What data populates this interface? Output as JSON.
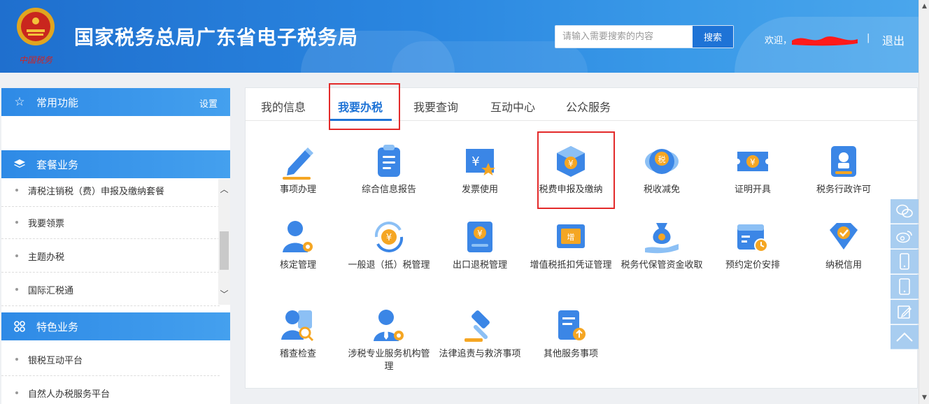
{
  "header": {
    "site_title": "国家税务总局广东省电子税务局",
    "emblem_caption": "中国税务",
    "search_placeholder": "请输入需要搜索的内容",
    "search_button": "搜索",
    "welcome": "欢迎，",
    "separator": "|",
    "logout": "退出"
  },
  "sidebar": {
    "sections": [
      {
        "title": "常用功能",
        "icon": "star-icon",
        "action": "设置"
      },
      {
        "title": "套餐业务",
        "icon": "layers-icon"
      },
      {
        "title": "特色业务",
        "icon": "grid-icon"
      }
    ],
    "package_items": [
      "清税注销税（费）申报及缴纳套餐",
      "我要领票",
      "主题办税",
      "国际汇税通"
    ],
    "feature_items": [
      "银税互动平台",
      "自然人办税服务平台"
    ]
  },
  "tabs": [
    "我的信息",
    "我要办税",
    "我要查询",
    "互动中心",
    "公众服务"
  ],
  "active_tab": "我要办税",
  "services": [
    {
      "label": "事项办理",
      "icon": "pencil-icon"
    },
    {
      "label": "综合信息报告",
      "icon": "document-list-icon"
    },
    {
      "label": "发票使用",
      "icon": "invoice-star-icon"
    },
    {
      "label": "税费申报及缴纳",
      "icon": "yuan-box-icon"
    },
    {
      "label": "税收减免",
      "icon": "tax-coin-icon"
    },
    {
      "label": "证明开具",
      "icon": "yuan-ticket-icon"
    },
    {
      "label": "税务行政许可",
      "icon": "license-stamp-icon"
    },
    {
      "label": "核定管理",
      "icon": "user-gear-icon"
    },
    {
      "label": "一般退（抵）税管理",
      "icon": "yuan-refund-icon"
    },
    {
      "label": "出口退税管理",
      "icon": "yuan-book-icon"
    },
    {
      "label": "增值税抵扣凭证管理",
      "icon": "vat-ticket-icon"
    },
    {
      "label": "税务代保管资金收取",
      "icon": "money-bag-hand-icon"
    },
    {
      "label": "预约定价安排",
      "icon": "calendar-clock-icon"
    },
    {
      "label": "纳税信用",
      "icon": "diamond-check-icon"
    },
    {
      "label": "稽查检查",
      "icon": "inspect-person-icon"
    },
    {
      "label": "涉税专业服务机构管理",
      "icon": "agent-gear-icon"
    },
    {
      "label": "法律追责与救济事项",
      "icon": "gavel-icon"
    },
    {
      "label": "其他服务事项",
      "icon": "doc-upload-icon"
    }
  ],
  "float_toolbar": [
    "wechat-icon",
    "weibo-icon",
    "mobile-icon",
    "tablet-icon",
    "feedback-icon",
    "back-to-top-icon"
  ],
  "colors": {
    "brand_blue": "#1e73d6",
    "highlight_red": "#e32a2a",
    "header_light": "#4aa6ec"
  }
}
